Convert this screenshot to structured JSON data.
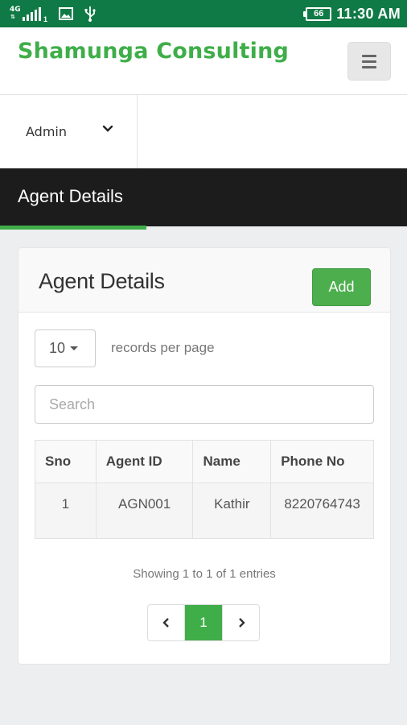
{
  "status_bar": {
    "network": "4G",
    "sim_slot": "1",
    "battery": "66",
    "time": "11:30 AM"
  },
  "header": {
    "brand": "Shamunga Consulting"
  },
  "nav": {
    "user_menu": "Admin"
  },
  "page": {
    "title": "Agent Details"
  },
  "card": {
    "title": "Agent Details",
    "add_label": "Add",
    "page_length": "10",
    "page_length_label": "records per page",
    "search_placeholder": "Search",
    "columns": [
      "Sno",
      "Agent ID",
      "Name",
      "Phone No"
    ],
    "rows": [
      [
        "1",
        "AGN001",
        "Kathir",
        "8220764743"
      ]
    ],
    "info": "Showing 1 to 1 of 1 entries",
    "pagination": {
      "current": "1"
    }
  },
  "colors": {
    "status_bar": "#0f7a45",
    "brand_green": "#3fae49",
    "button_green": "#4cae4c",
    "title_band": "#1c1c1c"
  },
  "icons": [
    "signal-icon",
    "image-icon",
    "usb-icon",
    "battery-icon",
    "hamburger-icon",
    "chevron-down-icon",
    "chevron-left-icon",
    "chevron-right-icon"
  ]
}
